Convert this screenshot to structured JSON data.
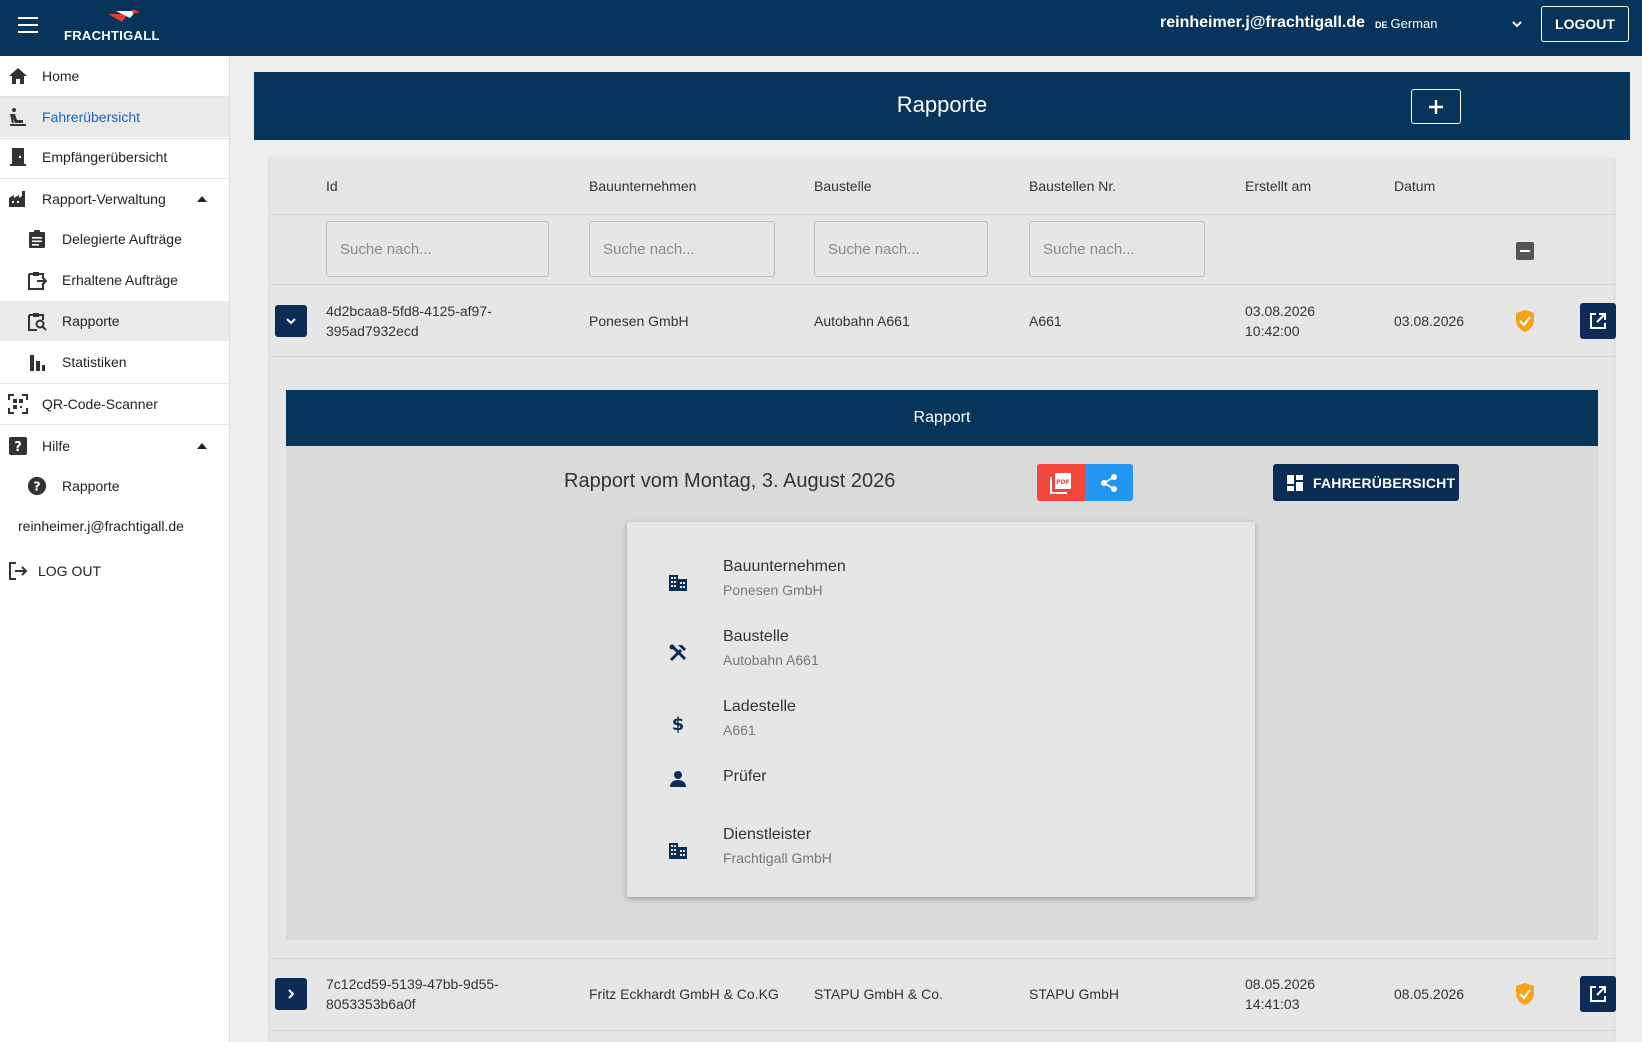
{
  "app": {
    "brand": "FRACHTIGALL",
    "user_email": "reinheimer.j@frachtigall.de",
    "language_flag": "DE",
    "language": "German",
    "logout_label": "LOGOUT"
  },
  "sidebar": {
    "items": [
      {
        "label": "Home",
        "icon": "home-icon"
      },
      {
        "label": "Fahrerübersicht",
        "icon": "driver-icon"
      },
      {
        "label": "Empfängerübersicht",
        "icon": "door-icon"
      },
      {
        "label": "Rapport-Verwaltung",
        "icon": "factory-icon"
      },
      {
        "label": "Delegierte Aufträge",
        "icon": "clipboard-icon"
      },
      {
        "label": "Erhaltene Aufträge",
        "icon": "clipboard-arrow-icon"
      },
      {
        "label": "Rapporte",
        "icon": "clipboard-search-icon"
      },
      {
        "label": "Statistiken",
        "icon": "bar-chart-icon"
      },
      {
        "label": "QR-Code-Scanner",
        "icon": "qr-scanner-icon"
      },
      {
        "label": "Hilfe",
        "icon": "help-square-icon"
      },
      {
        "label": "Rapporte",
        "icon": "help-circle-icon"
      }
    ],
    "email": "reinheimer.j@frachtigall.de",
    "logout_label": "LOG OUT"
  },
  "page": {
    "title": "Rapporte"
  },
  "table": {
    "columns": [
      "Id",
      "Bauunternehmen",
      "Baustelle",
      "Baustellen Nr.",
      "Erstellt am",
      "Datum"
    ],
    "search_placeholder": "Suche nach...",
    "rows": [
      {
        "id_line1": "4d2bcaa8-5fd8-4125-af97-",
        "id_line2": "395ad7932ecd",
        "bauunternehmen": "Ponesen GmbH",
        "baustelle": "Autobahn A661",
        "baustellen_nr": "A661",
        "erstellt_date": "03.08.2026",
        "erstellt_time": "10:42:00",
        "datum": "03.08.2026"
      },
      {
        "id_line1": "7c12cd59-5139-47bb-9d55-",
        "id_line2": "8053353b6a0f",
        "bauunternehmen": "Fritz Eckhardt GmbH & Co.KG",
        "baustelle": "STAPU GmbH & Co.",
        "baustellen_nr": "STAPU GmbH",
        "erstellt_date": "08.05.2026",
        "erstellt_time": "14:41:03",
        "datum": "08.05.2026"
      }
    ]
  },
  "detail": {
    "header": "Rapport",
    "title": "Rapport vom Montag, 3. August 2026",
    "fahrer_button": "FAHRERÜBERSICHT",
    "info": [
      {
        "title": "Bauunternehmen",
        "sub": "Ponesen GmbH",
        "icon": "building-icon"
      },
      {
        "title": "Baustelle",
        "sub": "Autobahn A661",
        "icon": "tools-icon"
      },
      {
        "title": "Ladestelle",
        "sub": "A661",
        "icon": "dollar-icon"
      },
      {
        "title": "Prüfer",
        "sub": "",
        "icon": "person-icon"
      },
      {
        "title": "Dienstleister",
        "sub": "Frachtigall GmbH",
        "icon": "building-icon"
      }
    ]
  },
  "colors": {
    "primary": "#06345a",
    "button_dark": "#0b2c55",
    "pdf": "#f0463c",
    "share": "#2196f3",
    "status_badge": "#f7a21b"
  }
}
